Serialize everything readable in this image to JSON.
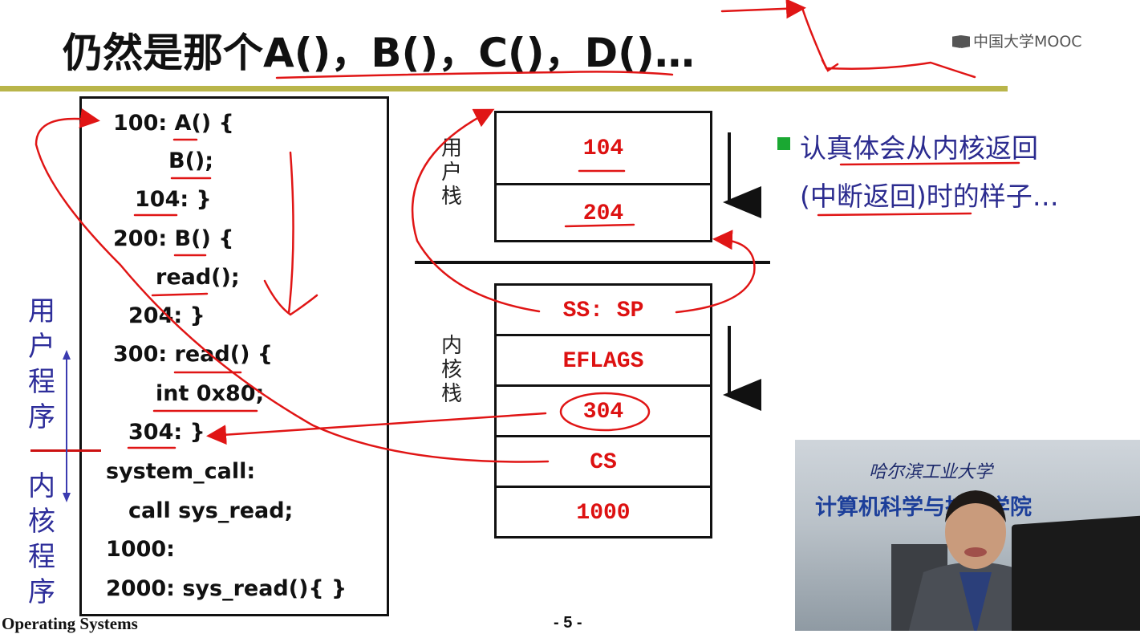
{
  "slide": {
    "title": "仍然是那个A()，B()，C()，D()…",
    "logo_text": "中国大学MOOC",
    "footer_left": "Operating Systems",
    "page_number": "- 5 -"
  },
  "code_lines": [
    "100: A() {",
    "B();",
    "104: }",
    "200: B() {",
    "read();",
    "204: }",
    "300: read() {",
    "int 0x80;",
    "304: }",
    "system_call:",
    "call sys_read;",
    "1000:",
    "2000: sys_read(){    }"
  ],
  "side_labels": {
    "user_program": "用户程序",
    "kernel_program": "内核程序"
  },
  "user_stack": {
    "label": "用户栈",
    "cells": [
      "104",
      "204"
    ]
  },
  "kernel_stack": {
    "label": "内核栈",
    "cells": [
      "SS: SP",
      "EFLAGS",
      "304",
      "CS",
      "1000"
    ]
  },
  "bullet": {
    "line1": "认真体会从内核返回",
    "line2": "(中断返回)时的样子…"
  },
  "video": {
    "banner_top": "哈尔滨工业大学",
    "banner_main": "计算机科学与技术学院"
  },
  "colors": {
    "title_rule": "#b9b54a",
    "annotation_red": "#e01515",
    "bullet_green": "#1aa832",
    "bullet_text": "#2b2b8f",
    "stack_text": "#dd1111"
  }
}
